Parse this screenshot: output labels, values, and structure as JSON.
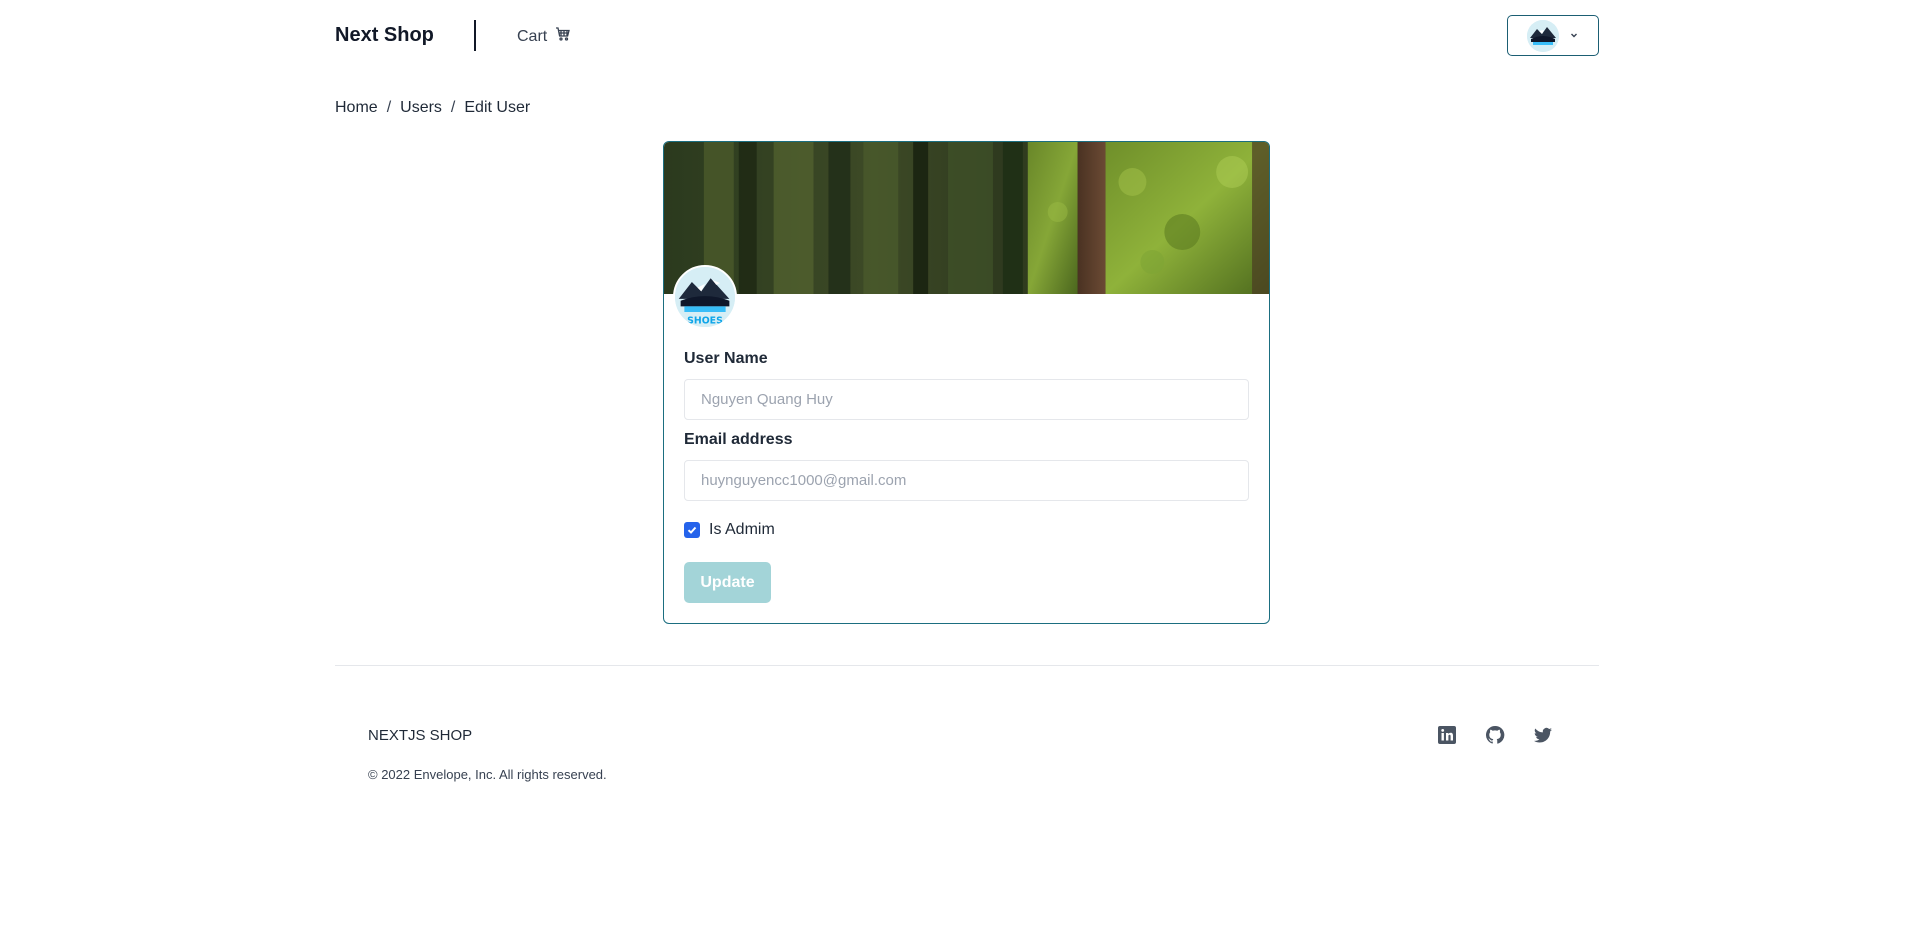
{
  "header": {
    "brand": "Next Shop",
    "cart_label": "Cart",
    "cart_icon": "cart-icon",
    "profile_icon": "chevron-down-icon"
  },
  "breadcrumb": {
    "items": [
      "Home",
      "Users",
      "Edit User"
    ],
    "separator": "/"
  },
  "form": {
    "username_label": "User Name",
    "username_placeholder": "Nguyen Quang Huy",
    "email_label": "Email address",
    "email_placeholder": "huynguyencc1000@gmail.com",
    "admin_label": "Is Admim",
    "admin_checked": true,
    "submit_label": "Update"
  },
  "footer": {
    "brand": "NEXTJS SHOP",
    "copyright": "© 2022 Envelope, Inc. All rights reserved.",
    "social_icons": [
      "linkedin-icon",
      "github-icon",
      "twitter-icon"
    ]
  },
  "colors": {
    "accent_border": "#1b6e80",
    "update_button": "#a3d4d8",
    "checkbox": "#2563eb"
  }
}
